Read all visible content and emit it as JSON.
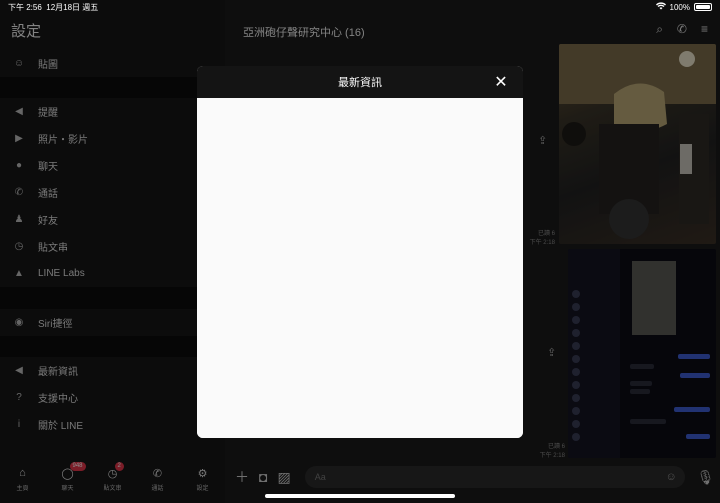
{
  "status": {
    "time": "下午 2:56",
    "date": "12月18日 週五",
    "battery": "100%"
  },
  "settings": {
    "title": "設定",
    "group1": [
      {
        "label": "貼圖",
        "icon": "smiley-icon"
      }
    ],
    "group2": [
      {
        "label": "提醒",
        "icon": "speaker-icon"
      },
      {
        "label": "照片・影片",
        "icon": "play-icon"
      },
      {
        "label": "聊天",
        "icon": "chat-bubble-icon"
      },
      {
        "label": "通話",
        "icon": "phone-icon"
      },
      {
        "label": "好友",
        "icon": "people-icon"
      },
      {
        "label": "貼文串",
        "icon": "clock-icon"
      },
      {
        "label": "LINE Labs",
        "icon": "flask-icon"
      }
    ],
    "group3": [
      {
        "label": "Siri捷徑",
        "icon": "siri-icon"
      }
    ],
    "group4": [
      {
        "label": "最新資訊",
        "icon": "megaphone-icon"
      },
      {
        "label": "支援中心",
        "icon": "question-icon"
      },
      {
        "label": "關於 LINE",
        "icon": "info-icon"
      }
    ]
  },
  "tabs": [
    {
      "label": "主頁",
      "icon": "home-icon",
      "badge": ""
    },
    {
      "label": "聊天",
      "icon": "chat-icon",
      "badge": "948"
    },
    {
      "label": "貼文串",
      "icon": "timeline-icon",
      "badge": "2"
    },
    {
      "label": "通話",
      "icon": "phone-icon",
      "badge": ""
    },
    {
      "label": "設定",
      "icon": "gear-icon",
      "badge": ""
    }
  ],
  "chat": {
    "title": "亞洲砲仔聲研究中心 (16)",
    "msg1_read": "已讀 6",
    "msg1_time": "下午 2:18",
    "msg2_read": "已讀 6",
    "msg2_time": "下午 2:18",
    "input_placeholder": "Aa"
  },
  "modal": {
    "title": "最新資訊"
  }
}
